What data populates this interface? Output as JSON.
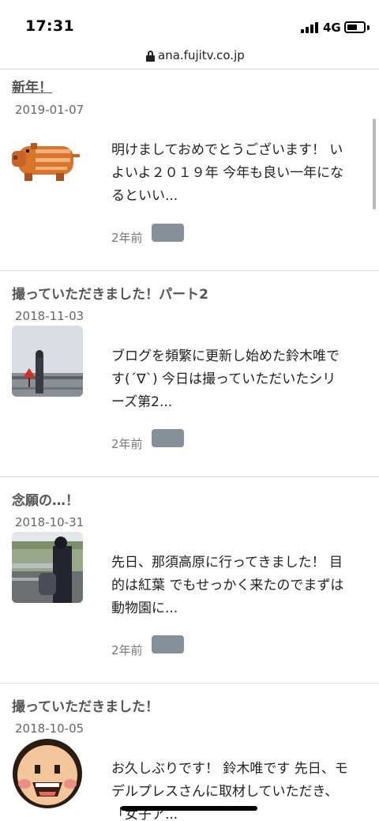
{
  "status_bar": {
    "time": "17:31",
    "network": "4G"
  },
  "browser": {
    "url": "ana.fujitv.co.jp"
  },
  "posts": [
    {
      "title": "新年！",
      "date": "2019-01-07",
      "excerpt": "明けましておめでとうございます！ いよいよ２０１９年 今年も良い一年になるといい...",
      "ago": "2年前"
    },
    {
      "title": "撮っていただきました！パート2",
      "date": "2018-11-03",
      "excerpt": "ブログを頻繁に更新し始めた鈴木唯です(´∇`) 今日は撮っていただいたシリーズ第2...",
      "ago": "2年前"
    },
    {
      "title": "念願の…！",
      "date": "2018-10-31",
      "excerpt": "先日、那須高原に行ってきました！ 目的は紅葉 でもせっかく来たのでまずは動物園に...",
      "ago": "2年前"
    },
    {
      "title": "撮っていただきました！",
      "date": "2018-10-05",
      "excerpt": "お久しぶりです！ 鈴木唯です 先日、モデルプレスさんに取材していただき、「女子ア..."
    }
  ]
}
